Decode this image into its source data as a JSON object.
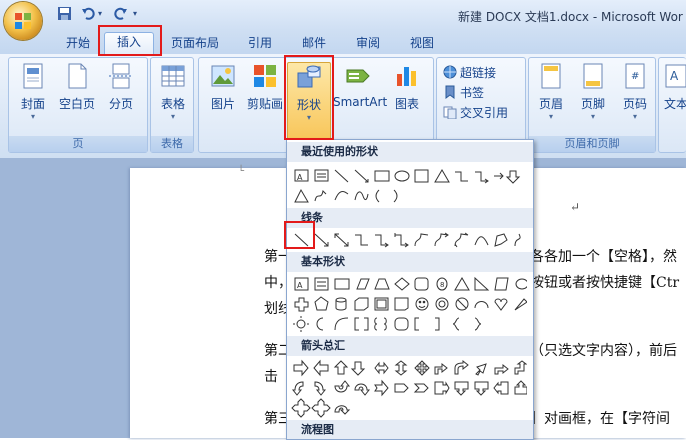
{
  "window": {
    "title": "新建 DOCX 文档1.docx - Microsoft Wor"
  },
  "quick_access": {
    "icons": [
      "save-icon",
      "undo-icon",
      "redo-icon"
    ]
  },
  "tabs": [
    {
      "label": "开始"
    },
    {
      "label": "插入",
      "active": true
    },
    {
      "label": "页面布局"
    },
    {
      "label": "引用"
    },
    {
      "label": "邮件"
    },
    {
      "label": "审阅"
    },
    {
      "label": "视图"
    }
  ],
  "ribbon": {
    "groups": {
      "page": {
        "label": "页",
        "buttons": [
          "封面",
          "空白页",
          "分页"
        ]
      },
      "table": {
        "label": "表格",
        "buttons": [
          "表格"
        ]
      },
      "illustrations": {
        "buttons": [
          "图片",
          "剪贴画",
          "形状",
          "SmartArt",
          "图表"
        ]
      },
      "links": {
        "buttons": [
          "超链接",
          "书签",
          "交叉引用"
        ]
      },
      "header_footer": {
        "label": "页眉和页脚",
        "buttons": [
          "页眉",
          "页脚",
          "页码"
        ]
      },
      "text": {
        "buttons": [
          "文本"
        ]
      }
    }
  },
  "shape_panel": {
    "sections": [
      "最近使用的形状",
      "线条",
      "基本形状",
      "箭头总汇",
      "流程图"
    ]
  },
  "document": {
    "lines": [
      "第一",
      "各各加一个【空格】，然",
      "中，",
      "按钮或者按快捷键【Ctr",
      "划线",
      "第二",
      "（只选文字内容），前后",
      "击",
      "第三",
      "】对画框，在【字符间",
      "↵"
    ]
  },
  "colors": {
    "highlight": "#e31a1a",
    "ribbon_text": "#15428b"
  }
}
